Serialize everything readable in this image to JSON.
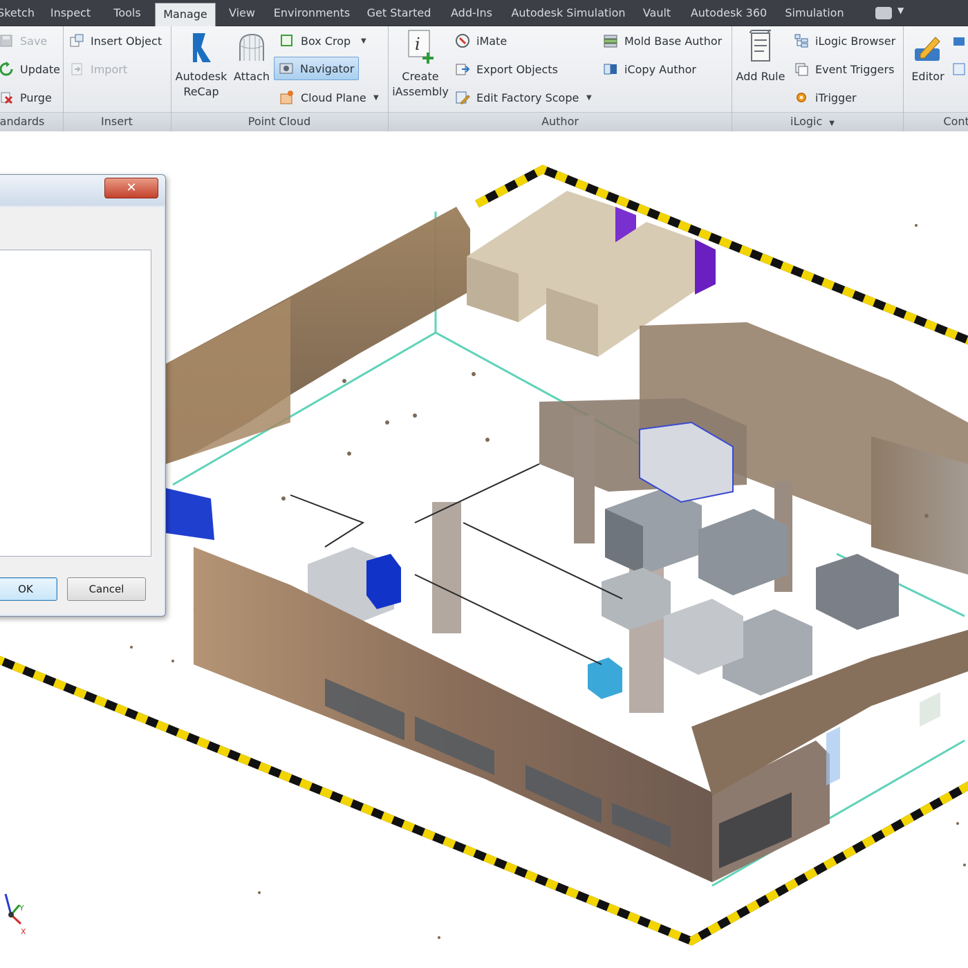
{
  "tabs": [
    "Sketch",
    "Inspect",
    "Tools",
    "Manage",
    "View",
    "Environments",
    "Get Started",
    "Add-Ins",
    "Autodesk Simulation",
    "Vault",
    "Autodesk 360",
    "Simulation"
  ],
  "active_tab": "Manage",
  "ribbon": {
    "standards": {
      "title": "andards",
      "save": "Save",
      "update": "Update",
      "purge": "Purge"
    },
    "insert": {
      "title": "Insert",
      "insert_object": "Insert Object",
      "import": "Import"
    },
    "point_cloud": {
      "title": "Point Cloud",
      "recap_line1": "Autodesk",
      "recap_line2": "ReCap",
      "attach": "Attach",
      "box_crop": "Box Crop",
      "navigator": "Navigator",
      "cloud_plane": "Cloud Plane"
    },
    "author": {
      "title": "Author",
      "create_line1": "Create",
      "create_line2": "iAssembly",
      "imate": "iMate",
      "export_objects": "Export Objects",
      "edit_factory_scope": "Edit Factory Scope",
      "mold_base_author": "Mold Base Author",
      "icopy_author": "iCopy Author"
    },
    "ilogic": {
      "title": "iLogic",
      "add_rule": "Add Rule",
      "ilogic_browser": "iLogic Browser",
      "event_triggers": "Event Triggers",
      "itrigger": "iTrigger"
    },
    "contents": {
      "title": "Conte",
      "editor": "Editor"
    }
  },
  "dialog": {
    "ok": "OK",
    "cancel": "Cancel"
  },
  "triad": {
    "x": "X",
    "y": "Y"
  },
  "colors": {
    "tabbar": "#3c3f45",
    "hatch_yellow": "#f2d400",
    "grid_line": "#5fd3b8",
    "floor": "#ffffff"
  }
}
